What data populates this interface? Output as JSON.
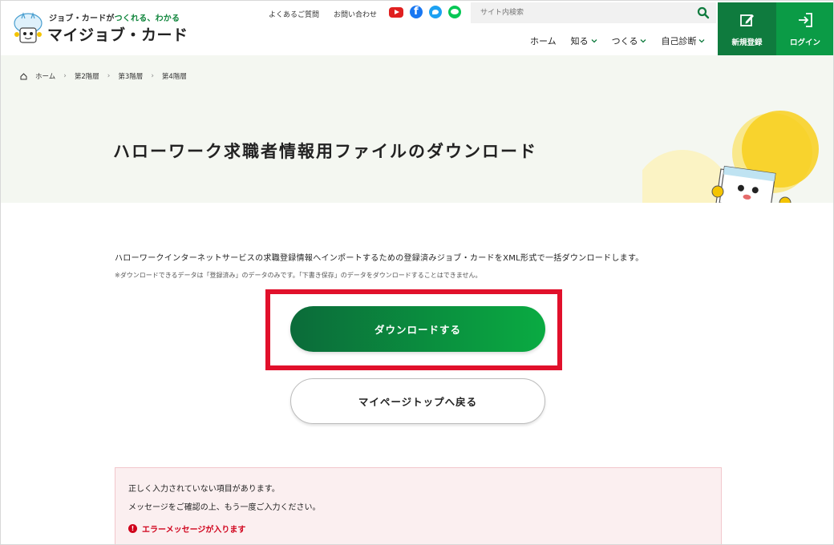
{
  "header": {
    "logo": {
      "tagline_prefix": "ジョブ・カードが",
      "tagline_highlight": "つくれる、わかる",
      "name": "マイジョブ・カード"
    },
    "util_links": [
      "よくあるご質問",
      "お問い合わせ"
    ],
    "social": [
      "youtube-icon",
      "facebook-icon",
      "twitter-icon",
      "line-icon"
    ],
    "search": {
      "placeholder": "サイト内検索"
    },
    "nav": [
      {
        "label": "ホーム",
        "dropdown": false
      },
      {
        "label": "知る",
        "dropdown": true
      },
      {
        "label": "つくる",
        "dropdown": true
      },
      {
        "label": "自己診断",
        "dropdown": true
      }
    ],
    "register_label": "新規登録",
    "login_label": "ログイン"
  },
  "breadcrumb": [
    "ホーム",
    "第2階層",
    "第3階層",
    "第4階層"
  ],
  "page_title": "ハローワーク求職者情報用ファイルのダウンロード",
  "content": {
    "description": "ハローワークインターネットサービスの求職登録情報へインポートするための登録済みジョブ・カードをXML形式で一括ダウンロードします。",
    "note": "※ダウンロードできるデータは「登録済み」のデータのみです。「下書き保存」のデータをダウンロードすることはできません。",
    "download_label": "ダウンロードする",
    "back_label": "マイページトップへ戻る"
  },
  "error": {
    "line1": "正しく入力されていない項目があります。",
    "line2": "メッセージをご確認の上、もう一度ご入力ください。",
    "message": "エラーメッセージが入ります"
  },
  "colors": {
    "brand_green": "#0f7b3e",
    "brand_green_light": "#0b9b46",
    "highlight_red": "#e1102b",
    "error_red": "#d0021b"
  }
}
